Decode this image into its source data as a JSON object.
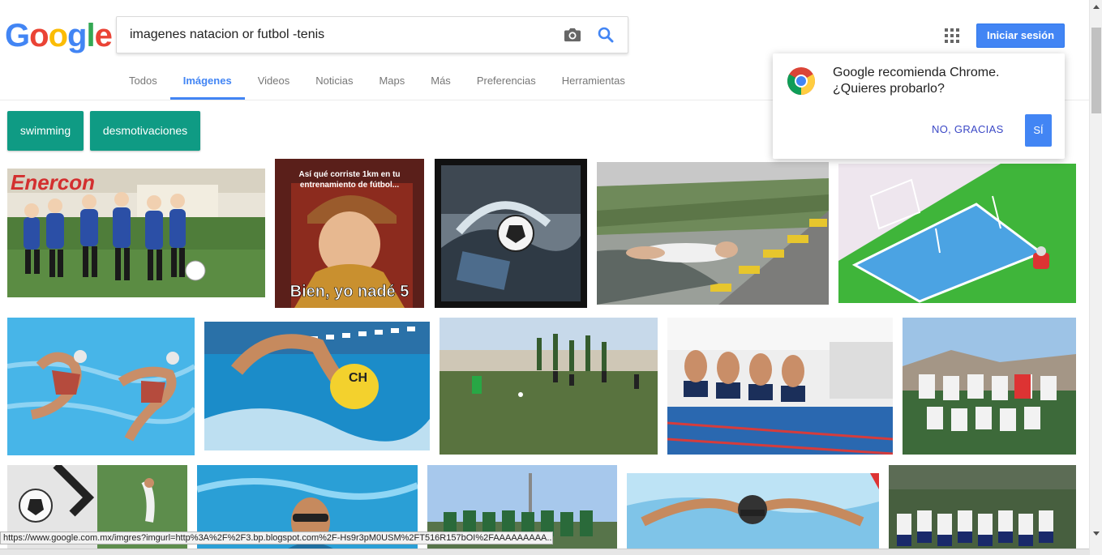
{
  "logo": {
    "letters": [
      "G",
      "o",
      "o",
      "g",
      "l",
      "e"
    ],
    "colors": [
      "#4285f4",
      "#ea4335",
      "#fbbc05",
      "#4285f4",
      "#34a853",
      "#ea4335"
    ]
  },
  "search": {
    "query": "imagenes natacion or futbol -tenis"
  },
  "header": {
    "signin_label": "Iniciar sesión"
  },
  "tabs": [
    {
      "label": "Todos",
      "active": false
    },
    {
      "label": "Imágenes",
      "active": true
    },
    {
      "label": "Videos",
      "active": false
    },
    {
      "label": "Noticias",
      "active": false
    },
    {
      "label": "Maps",
      "active": false
    },
    {
      "label": "Más",
      "active": false
    },
    {
      "label": "Preferencias",
      "active": false
    },
    {
      "label": "Herramientas",
      "active": false
    }
  ],
  "chips": [
    {
      "label": "swimming"
    },
    {
      "label": "desmotivaciones"
    }
  ],
  "meme": {
    "top_text_1": "Así qué corriste 1km en tu",
    "top_text_2": "entrenamiento de fútbol...",
    "bottom_text": "Bien, yo nadé 5"
  },
  "chrome_popup": {
    "message_line1": "Google recomienda Chrome.",
    "message_line2": "¿Quieres probarlo?",
    "decline_label": "NO, GRACIAS",
    "accept_label": "SÍ"
  },
  "status_bar": {
    "url": "https://www.google.com.mx/imgres?imgurl=http%3A%2F%2F3.bp.blogspot.com%2F-Hs9r3pM0USM%2FT516R157bOI%2FAAAAAAAAA..."
  },
  "colors": {
    "accent": "#4285f4",
    "chip": "#0f9b84",
    "tab_active": "#4285f4"
  }
}
